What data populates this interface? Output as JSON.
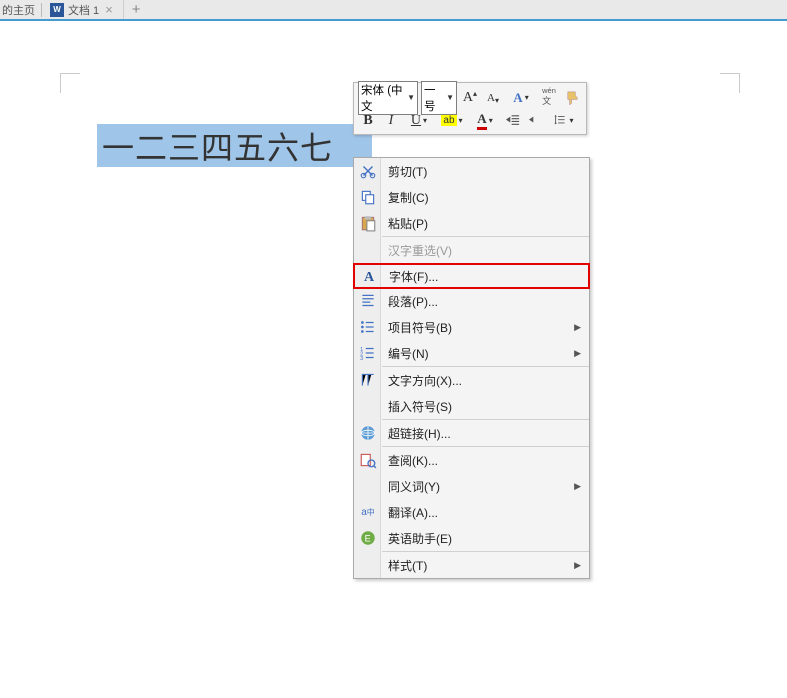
{
  "tabs": {
    "home": "的主页",
    "file": "文档 1"
  },
  "doc": {
    "selected_text": "一二三四五六七"
  },
  "mini_toolbar": {
    "font_name": "宋体 (中文",
    "font_size": "一号"
  },
  "context_menu": {
    "cut": "剪切(T)",
    "copy": "复制(C)",
    "paste": "粘贴(P)",
    "reselect": "汉字重选(V)",
    "font": "字体(F)...",
    "paragraph": "段落(P)...",
    "bullets": "项目符号(B)",
    "numbering": "编号(N)",
    "text_direction": "文字方向(X)...",
    "insert_symbol": "插入符号(S)",
    "hyperlink": "超链接(H)...",
    "review": "查阅(K)...",
    "synonym": "同义词(Y)",
    "translate": "翻译(A)...",
    "english_assistant": "英语助手(E)",
    "style": "样式(T)"
  }
}
